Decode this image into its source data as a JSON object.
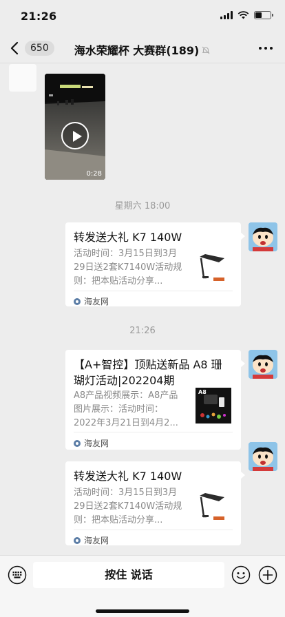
{
  "status_bar": {
    "time": "21:26",
    "battery_level": 0.45
  },
  "nav": {
    "unread_count": "650",
    "title": "海水荣耀杯 大赛群(189)"
  },
  "messages": {
    "video": {
      "duration": "0:28"
    },
    "time_divider_1": "星期六 18:00",
    "card1": {
      "title": "转发送大礼  K7 140W",
      "desc": "活动时间：3月15日到3月29日送2套K7140W活动规则：把本贴活动分享...",
      "source": "海友网"
    },
    "time_divider_2": "21:26",
    "card2": {
      "title": "【A+智控】顶贴送新品 A8 珊瑚灯活动|202204期",
      "desc": "A8产品视频展示：A8产品图片展示：活动时间：2022年3月21日到4月2...",
      "source": "海友网",
      "thumb_label": "A8"
    },
    "card3": {
      "title": "转发送大礼  K7 140W",
      "desc": "活动时间：3月15日到3月29日送2套K7140W活动规则：把本贴活动分享...",
      "source": "海友网"
    }
  },
  "input_bar": {
    "hold_to_talk": "按住 说话"
  },
  "colors": {
    "background": "#ededed",
    "card": "#ffffff",
    "muted_text": "#8a8a8a",
    "source_icon": "#5b7da6"
  }
}
